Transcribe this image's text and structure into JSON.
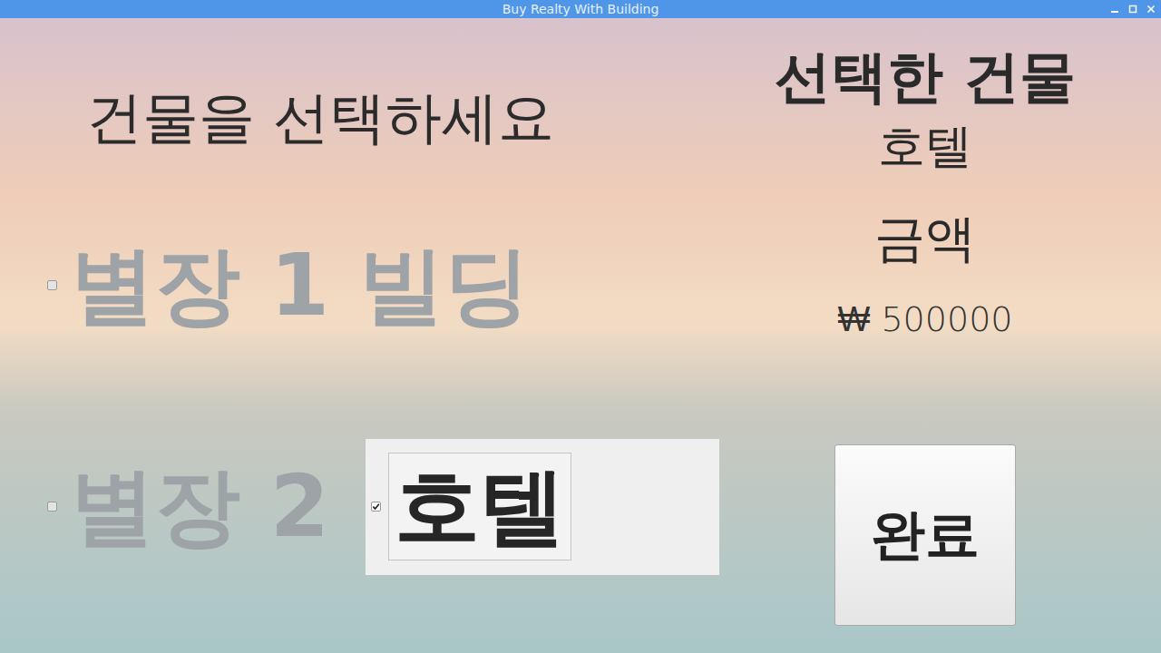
{
  "window": {
    "title": "Buy Realty With Building"
  },
  "heading": "건물을 선택하세요",
  "options": [
    {
      "label": "별장 1 빌딩",
      "checked": false,
      "selected": false
    },
    {
      "label": "별장 2",
      "checked": false,
      "selected": false
    },
    {
      "label": "호텔",
      "checked": true,
      "selected": true
    }
  ],
  "summary": {
    "title": "선택한 건물",
    "building": "호텔",
    "price_label": "금액",
    "price": "₩ 500000"
  },
  "buttons": [
    "완료"
  ]
}
